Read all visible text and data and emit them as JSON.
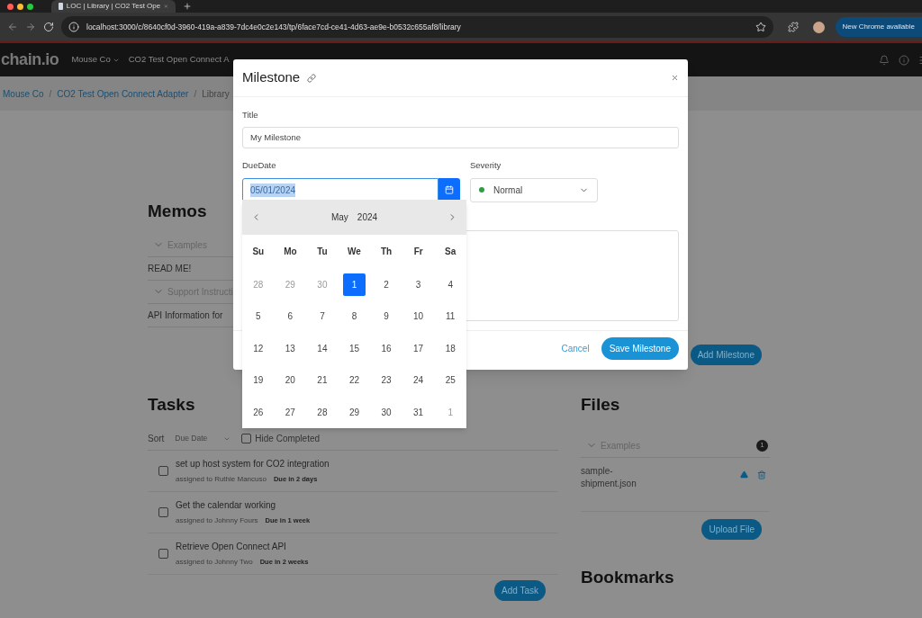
{
  "browser": {
    "tab_title": "LOC | Library | CO2 Test Ope",
    "url": "localhost:3000/c/8640cf0d-3960-419a-a839-7dc4e0c2e143/tp/6face7cd-ce41-4d63-ae9e-b0532c655af8/library",
    "update_button": "New Chrome available"
  },
  "app_header": {
    "logo": "chain.io",
    "nav": [
      "Mouse Co",
      "CO2 Test Open Connect A"
    ]
  },
  "breadcrumb": {
    "separator": "/",
    "items": [
      "Mouse Co",
      "CO2 Test Open Connect Adapter",
      "Library"
    ]
  },
  "memos": {
    "title": "Memos",
    "items": [
      {
        "kind": "group",
        "label": "Examples",
        "expanded": true
      },
      {
        "kind": "memo",
        "label": "READ ME!"
      },
      {
        "kind": "group",
        "label": "Support Instructi",
        "expanded": true
      },
      {
        "kind": "memo",
        "label": "API Information for"
      }
    ]
  },
  "add_milestone_button": "Add Milestone",
  "tasks": {
    "title": "Tasks",
    "sort_label": "Sort",
    "sort_value": "Due Date",
    "hide_completed": {
      "label": "Hide Completed",
      "checked": false
    },
    "items": [
      {
        "title": "set up host system for CO2 integration",
        "assignee": "assigned to Ruthie Mancuso",
        "due": "Due in 2 days",
        "checked": false
      },
      {
        "title": "Get the calendar working",
        "assignee": "assigned to Johnny Fours",
        "due": "Due in 1 week",
        "checked": false
      },
      {
        "title": "Retrieve Open Connect API",
        "assignee": "assigned to Johnny Two",
        "due": "Due in 2 weeks",
        "checked": false
      }
    ],
    "add_button": "Add Task"
  },
  "files": {
    "title": "Files",
    "groups": [
      {
        "label": "Examples",
        "expanded": true,
        "count": "1",
        "files": [
          "sample-shipment.json"
        ]
      }
    ],
    "upload_button": "Upload File"
  },
  "bookmarks": {
    "title": "Bookmarks"
  },
  "modal": {
    "title": "Milestone",
    "title_label": "Title",
    "title_value": "My Milestone",
    "due_label": "DueDate",
    "due_value": "05/01/2024",
    "severity_label": "Severity",
    "severity": {
      "label": "Normal",
      "color": "#2e9e44"
    },
    "cancel": "Cancel",
    "save": "Save Milestone",
    "calendar": {
      "month": "May",
      "year": "2024",
      "weekdays": [
        "Su",
        "Mo",
        "Tu",
        "We",
        "Th",
        "Fr",
        "Sa"
      ],
      "weeks": [
        [
          {
            "day": "28",
            "outside": true,
            "selected": false
          },
          {
            "day": "29",
            "outside": true,
            "selected": false
          },
          {
            "day": "30",
            "outside": true,
            "selected": false
          },
          {
            "day": "1",
            "outside": false,
            "selected": true
          },
          {
            "day": "2",
            "outside": false,
            "selected": false
          },
          {
            "day": "3",
            "outside": false,
            "selected": false
          },
          {
            "day": "4",
            "outside": false,
            "selected": false
          }
        ],
        [
          {
            "day": "5",
            "outside": false,
            "selected": false
          },
          {
            "day": "6",
            "outside": false,
            "selected": false
          },
          {
            "day": "7",
            "outside": false,
            "selected": false
          },
          {
            "day": "8",
            "outside": false,
            "selected": false
          },
          {
            "day": "9",
            "outside": false,
            "selected": false
          },
          {
            "day": "10",
            "outside": false,
            "selected": false
          },
          {
            "day": "11",
            "outside": false,
            "selected": false
          }
        ],
        [
          {
            "day": "12",
            "outside": false,
            "selected": false
          },
          {
            "day": "13",
            "outside": false,
            "selected": false
          },
          {
            "day": "14",
            "outside": false,
            "selected": false
          },
          {
            "day": "15",
            "outside": false,
            "selected": false
          },
          {
            "day": "16",
            "outside": false,
            "selected": false
          },
          {
            "day": "17",
            "outside": false,
            "selected": false
          },
          {
            "day": "18",
            "outside": false,
            "selected": false
          }
        ],
        [
          {
            "day": "19",
            "outside": false,
            "selected": false
          },
          {
            "day": "20",
            "outside": false,
            "selected": false
          },
          {
            "day": "21",
            "outside": false,
            "selected": false
          },
          {
            "day": "22",
            "outside": false,
            "selected": false
          },
          {
            "day": "23",
            "outside": false,
            "selected": false
          },
          {
            "day": "24",
            "outside": false,
            "selected": false
          },
          {
            "day": "25",
            "outside": false,
            "selected": false
          }
        ],
        [
          {
            "day": "26",
            "outside": false,
            "selected": false
          },
          {
            "day": "27",
            "outside": false,
            "selected": false
          },
          {
            "day": "28",
            "outside": false,
            "selected": false
          },
          {
            "day": "29",
            "outside": false,
            "selected": false
          },
          {
            "day": "30",
            "outside": false,
            "selected": false
          },
          {
            "day": "31",
            "outside": false,
            "selected": false
          },
          {
            "day": "1",
            "outside": true,
            "selected": false
          }
        ]
      ]
    }
  }
}
